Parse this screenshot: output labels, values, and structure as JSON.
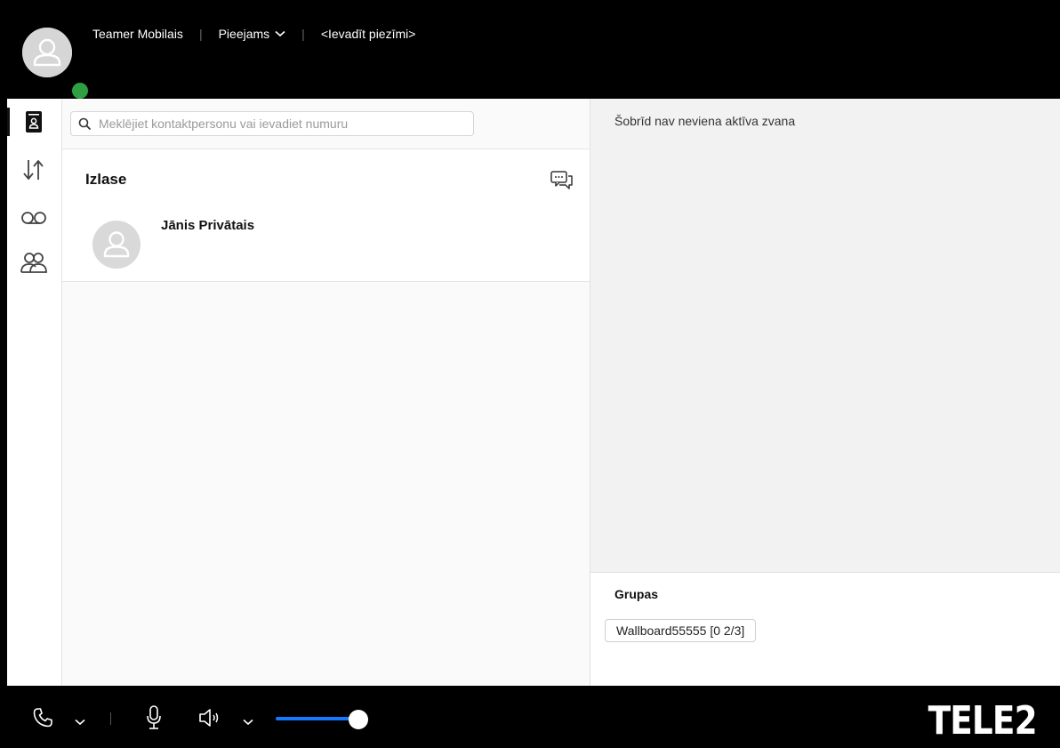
{
  "header": {
    "user_name": "Teamer Mobilais",
    "status": "Pieejams",
    "note_placeholder": "<Ievadīt piezīmi>"
  },
  "colors": {
    "presence": "#2ea043",
    "volume_accent": "#1677ff"
  },
  "rail": {
    "items": [
      {
        "icon": "contacts-book-icon",
        "active": true
      },
      {
        "icon": "call-history-arrows-icon",
        "active": false
      },
      {
        "icon": "voicemail-icon",
        "active": false
      },
      {
        "icon": "groups-icon",
        "active": false
      }
    ]
  },
  "contacts": {
    "search_placeholder": "Meklējiet kontaktpersonu vai ievadiet numuru",
    "section_title": "Izlase",
    "items": [
      {
        "name": "Jānis Privātais"
      }
    ]
  },
  "calls": {
    "empty_message": "Šobrīd nav neviena aktīva zvana"
  },
  "groups": {
    "title": "Grupas",
    "items": [
      {
        "label": "Wallboard55555 [0 2/3]"
      }
    ]
  },
  "bottom": {
    "volume_level": 0.85,
    "brand": "TELE2"
  }
}
